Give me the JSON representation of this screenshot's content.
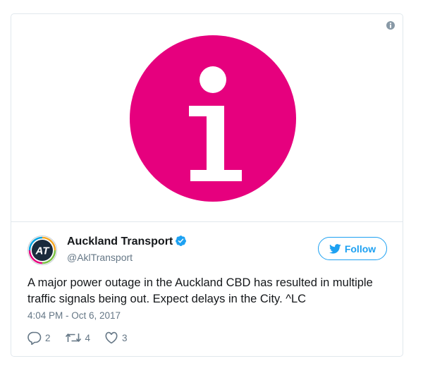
{
  "author": {
    "name": "Auckland Transport",
    "handle": "@AklTransport",
    "avatar_text": "AT"
  },
  "follow_button": {
    "label": "Follow"
  },
  "tweet": {
    "text_line1": "A major power outage in the Auckland CBD has resulted in multiple",
    "text_line2": "traffic signals being out. Expect delays in the City. ^LC",
    "timestamp": "4:04 PM - Oct 6, 2017"
  },
  "actions": {
    "reply_count": "2",
    "retweet_count": "4",
    "like_count": "3"
  },
  "icons": {
    "media_info": "info-icon",
    "verified": "verified-badge-icon",
    "follow": "twitter-bird-icon",
    "reply": "reply-icon",
    "retweet": "retweet-icon",
    "like": "heart-icon"
  },
  "colors": {
    "info_circle": "#e6007e",
    "twitter_blue": "#1da1f2",
    "text_primary": "#14171a",
    "text_secondary": "#657786"
  }
}
